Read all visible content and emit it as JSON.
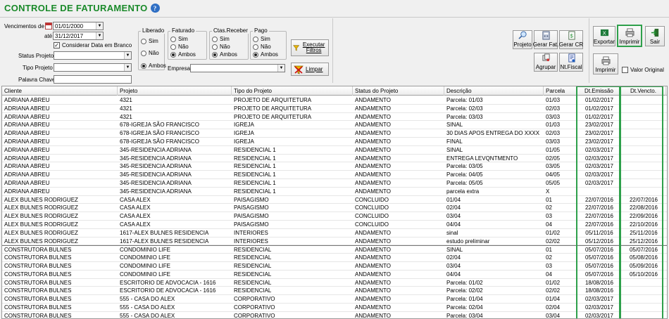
{
  "title": "CONTROLE DE FATURAMENTO",
  "help_icon": "help-icon",
  "filters": {
    "venc_label": "Vencimentos de",
    "venc_from": "01/01/2000",
    "ate_label": "até",
    "venc_to": "31/12/2017",
    "considerar_label": "Considerar Data em Branco",
    "status_label": "Status Projeto",
    "tipo_label": "Tipo Projeto",
    "palavra_label": "Palavra Chave",
    "empresa_label": "Empresa"
  },
  "groups": {
    "liberado": {
      "title": "Liberado",
      "opts": [
        "Sim",
        "Não",
        "Ambos"
      ]
    },
    "faturado": {
      "title": "Faturado",
      "opts": [
        "Sim",
        "Não",
        "Ambos"
      ]
    },
    "ctas": {
      "title": "Ctas.Receber",
      "opts": [
        "Sim",
        "Não",
        "Ambos"
      ]
    },
    "pago": {
      "title": "Pago",
      "opts": [
        "Sim",
        "Não",
        "Ambos"
      ]
    }
  },
  "buttons": {
    "executar": "Executar Filtros",
    "limpar": "Limpar",
    "projeto": "Projeto",
    "gerar_fat": "Gerar Fat.",
    "gerar_cr": "Gerar CR",
    "agrupar": "Agrupar",
    "nt_fiscal": "Nt.Fiscal",
    "exportar": "Exportar",
    "imprimir_top": "Imprimir",
    "sair": "Sair",
    "imprimir": "Imprimir",
    "valor_original": "Valor Original"
  },
  "columns": [
    "Cliente",
    "Projeto",
    "Tipo do Projeto",
    "Status do Projeto",
    "Descrição",
    "Parcela",
    "Dt.Emissão",
    "Dt.Vencto."
  ],
  "rows": [
    [
      "ADRIANA ABREU",
      "4321",
      "PROJETO DE ARQUITETURA",
      "ANDAMENTO",
      "Parcela: 01/03",
      "01/03",
      "01/02/2017",
      ""
    ],
    [
      "ADRIANA ABREU",
      "4321",
      "PROJETO DE ARQUITETURA",
      "ANDAMENTO",
      "Parcela: 02/03",
      "02/03",
      "01/02/2017",
      ""
    ],
    [
      "ADRIANA ABREU",
      "4321",
      "PROJETO DE ARQUITETURA",
      "ANDAMENTO",
      "Parcela: 03/03",
      "03/03",
      "01/02/2017",
      ""
    ],
    [
      "ADRIANA ABREU",
      "678-IGREJA SÃO FRANCISCO",
      "IGREJA",
      "ANDAMENTO",
      "SINAL",
      "01/03",
      "23/02/2017",
      ""
    ],
    [
      "ADRIANA ABREU",
      "678-IGREJA SÃO FRANCISCO",
      "IGREJA",
      "ANDAMENTO",
      "30 DIAS APOS ENTREGA DO XXXX",
      "02/03",
      "23/02/2017",
      ""
    ],
    [
      "ADRIANA ABREU",
      "678-IGREJA SÃO FRANCISCO",
      "IGREJA",
      "ANDAMENTO",
      "FINAL",
      "03/03",
      "23/02/2017",
      ""
    ],
    [
      "ADRIANA ABREU",
      "345-RESIDENCIA ADRIANA",
      "RESIDENCIAL 1",
      "ANDAMENTO",
      "SINAL",
      "01/05",
      "02/03/2017",
      ""
    ],
    [
      "ADRIANA ABREU",
      "345-RESIDENCIA ADRIANA",
      "RESIDENCIAL 1",
      "ANDAMENTO",
      "ENTREGA LEVQNTMENTO",
      "02/05",
      "02/03/2017",
      ""
    ],
    [
      "ADRIANA ABREU",
      "345-RESIDENCIA ADRIANA",
      "RESIDENCIAL 1",
      "ANDAMENTO",
      "Parcela: 03/05",
      "03/05",
      "02/03/2017",
      ""
    ],
    [
      "ADRIANA ABREU",
      "345-RESIDENCIA ADRIANA",
      "RESIDENCIAL 1",
      "ANDAMENTO",
      "Parcela: 04/05",
      "04/05",
      "02/03/2017",
      ""
    ],
    [
      "ADRIANA ABREU",
      "345-RESIDENCIA ADRIANA",
      "RESIDENCIAL 1",
      "ANDAMENTO",
      "Parcela: 05/05",
      "05/05",
      "02/03/2017",
      ""
    ],
    [
      "ADRIANA ABREU",
      "345-RESIDENCIA ADRIANA",
      "RESIDENCIAL 1",
      "ANDAMENTO",
      "parcela extra",
      "X",
      "",
      ""
    ],
    [
      "ALEX BULNES RODRIGUEZ",
      "CASA ALEX",
      "PAISAGISMO",
      "CONCLUIDO",
      "01/04",
      "01",
      "22/07/2016",
      "22/07/2016"
    ],
    [
      "ALEX BULNES RODRIGUEZ",
      "CASA ALEX",
      "PAISAGISMO",
      "CONCLUIDO",
      "02/04",
      "02",
      "22/07/2016",
      "22/08/2016"
    ],
    [
      "ALEX BULNES RODRIGUEZ",
      "CASA ALEX",
      "PAISAGISMO",
      "CONCLUIDO",
      "03/04",
      "03",
      "22/07/2016",
      "22/09/2016"
    ],
    [
      "ALEX BULNES RODRIGUEZ",
      "CASA ALEX",
      "PAISAGISMO",
      "CONCLUIDO",
      "04/04",
      "04",
      "22/07/2016",
      "22/10/2016"
    ],
    [
      "ALEX BULNES RODRIGUEZ",
      "1617-ALEX BULNES RESIDENCIA",
      "INTERIORES",
      "ANDAMENTO",
      "sinal",
      "01/02",
      "05/11/2016",
      "25/11/2016"
    ],
    [
      "ALEX BULNES RODRIGUEZ",
      "1617-ALEX BULNES RESIDENCIA",
      "INTERIORES",
      "ANDAMENTO",
      "estudo preliminar",
      "02/02",
      "05/12/2016",
      "25/12/2016"
    ],
    [
      "CONSTRUTORA BULNES",
      "CONDOMINIO LIFE",
      "RESIDENCIAL",
      "ANDAMENTO",
      "SINAL",
      "01",
      "05/07/2016",
      "05/07/2016"
    ],
    [
      "CONSTRUTORA BULNES",
      "CONDOMINIO LIFE",
      "RESIDENCIAL",
      "ANDAMENTO",
      "02/04",
      "02",
      "05/07/2016",
      "05/08/2016"
    ],
    [
      "CONSTRUTORA BULNES",
      "CONDOMINIO LIFE",
      "RESIDENCIAL",
      "ANDAMENTO",
      "03/04",
      "03",
      "05/07/2016",
      "05/09/2016"
    ],
    [
      "CONSTRUTORA BULNES",
      "CONDOMINIO LIFE",
      "RESIDENCIAL",
      "ANDAMENTO",
      "04/04",
      "04",
      "05/07/2016",
      "05/10/2016"
    ],
    [
      "CONSTRUTORA BULNES",
      "ESCRITORIO DE ADVOCACIA - 1616",
      "RESIDENCIAL",
      "ANDAMENTO",
      "Parcela: 01/02",
      "01/02",
      "18/08/2016",
      ""
    ],
    [
      "CONSTRUTORA BULNES",
      "ESCRITORIO DE ADVOCACIA - 1616",
      "RESIDENCIAL",
      "ANDAMENTO",
      "Parcela: 02/02",
      "02/02",
      "18/08/2016",
      ""
    ],
    [
      "CONSTRUTORA BULNES",
      "555 - CASA DO ALEX",
      "CORPORATIVO",
      "ANDAMENTO",
      "Parcela: 01/04",
      "01/04",
      "02/03/2017",
      ""
    ],
    [
      "CONSTRUTORA BULNES",
      "555 - CASA DO ALEX",
      "CORPORATIVO",
      "ANDAMENTO",
      "Parcela: 02/04",
      "02/04",
      "02/03/2017",
      ""
    ],
    [
      "CONSTRUTORA BULNES",
      "555 - CASA DO ALEX",
      "CORPORATIVO",
      "ANDAMENTO",
      "Parcela: 03/04",
      "03/04",
      "02/03/2017",
      ""
    ]
  ]
}
